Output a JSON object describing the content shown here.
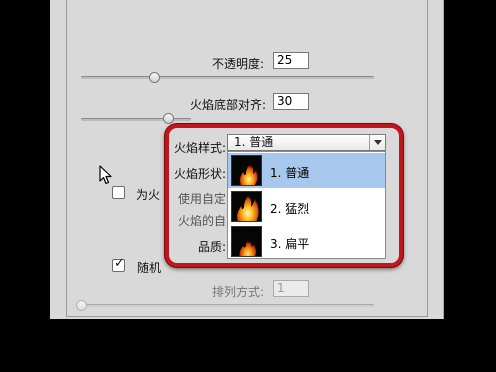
{
  "fields": {
    "opacity": {
      "label": "不透明度:",
      "value": "25",
      "slider_fraction": 0.25
    },
    "flame_bottom_align": {
      "label": "火焰底部对齐:",
      "value": "30",
      "slider_fraction": 0.3
    }
  },
  "flame_style": {
    "label": "火焰样式:",
    "selected": "1. 普通",
    "options": [
      {
        "label": "1. 普通",
        "icon": "flame-normal-thumbnail"
      },
      {
        "label": "2. 猛烈",
        "icon": "flame-violent-thumbnail"
      },
      {
        "label": "3. 扁平",
        "icon": "flame-flat-thumbnail"
      }
    ]
  },
  "behind_labels": {
    "flame_shape": "火焰形状:",
    "custom_color_checkbox": "为火",
    "custom_color_tail": "使用自定",
    "flame_self": "火焰的自",
    "quality": "品质:",
    "random": "随机"
  },
  "arrangement": {
    "label": "排列方式:",
    "value": "1"
  },
  "colors": {
    "highlight": "#c2161b",
    "selection": "#a8c7ec"
  }
}
